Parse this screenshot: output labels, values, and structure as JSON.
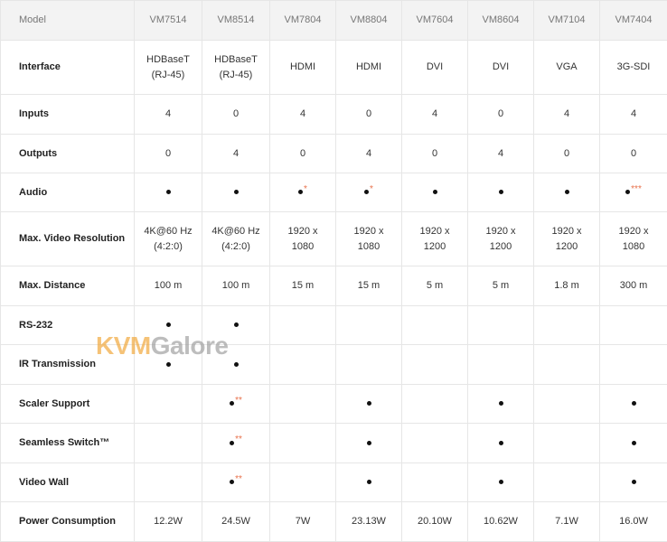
{
  "header": {
    "model_label": "Model",
    "models": [
      "VM7514",
      "VM8514",
      "VM7804",
      "VM8804",
      "VM7604",
      "VM8604",
      "VM7104",
      "VM7404"
    ]
  },
  "rows": [
    {
      "label": "Interface",
      "cells": [
        "HDBaseT\n(RJ-45)",
        "HDBaseT\n(RJ-45)",
        "HDMI",
        "HDMI",
        "DVI",
        "DVI",
        "VGA",
        "3G-SDI"
      ]
    },
    {
      "label": "Inputs",
      "cells": [
        "4",
        "0",
        "4",
        "0",
        "4",
        "0",
        "4",
        "4"
      ]
    },
    {
      "label": "Outputs",
      "cells": [
        "0",
        "4",
        "0",
        "4",
        "0",
        "4",
        "0",
        "0"
      ]
    },
    {
      "label": "Audio",
      "dots": [
        true,
        true,
        true,
        true,
        true,
        true,
        true,
        true
      ],
      "notes": [
        "",
        "",
        "*",
        "*",
        "",
        "",
        "",
        "***"
      ]
    },
    {
      "label": "Max. Video Resolution",
      "cells": [
        "4K@60 Hz\n(4:2:0)",
        "4K@60 Hz\n(4:2:0)",
        "1920 x\n1080",
        "1920 x\n1080",
        "1920 x\n1200",
        "1920 x\n1200",
        "1920 x\n1200",
        "1920 x\n1080"
      ]
    },
    {
      "label": "Max. Distance",
      "cells": [
        "100 m",
        "100 m",
        "15 m",
        "15 m",
        "5 m",
        "5 m",
        "1.8 m",
        "300 m"
      ]
    },
    {
      "label": "RS-232",
      "dots": [
        true,
        true,
        false,
        false,
        false,
        false,
        false,
        false
      ],
      "notes": [
        "",
        "",
        "",
        "",
        "",
        "",
        "",
        ""
      ]
    },
    {
      "label": "IR Transmission",
      "dots": [
        true,
        true,
        false,
        false,
        false,
        false,
        false,
        false
      ],
      "notes": [
        "",
        "",
        "",
        "",
        "",
        "",
        "",
        ""
      ]
    },
    {
      "label": "Scaler Support",
      "dots": [
        false,
        true,
        false,
        true,
        false,
        true,
        false,
        true
      ],
      "notes": [
        "",
        "**",
        "",
        "",
        "",
        "",
        "",
        ""
      ]
    },
    {
      "label": "Seamless Switch™",
      "dots": [
        false,
        true,
        false,
        true,
        false,
        true,
        false,
        true
      ],
      "notes": [
        "",
        "**",
        "",
        "",
        "",
        "",
        "",
        ""
      ]
    },
    {
      "label": "Video Wall",
      "dots": [
        false,
        true,
        false,
        true,
        false,
        true,
        false,
        true
      ],
      "notes": [
        "",
        "**",
        "",
        "",
        "",
        "",
        "",
        ""
      ]
    },
    {
      "label": "Power Consumption",
      "cells": [
        "12.2W",
        "24.5W",
        "7W",
        "23.13W",
        "20.10W",
        "10.62W",
        "7.1W",
        "16.0W"
      ]
    }
  ],
  "watermark": {
    "part1": "KVM",
    "part2": "Galore"
  },
  "colors": {
    "header_bg": "#f3f3f3",
    "grid": "#e6e6e6",
    "note": "#e8704a",
    "watermark_orange": "#f0a330",
    "watermark_gray": "#9a9a9a"
  }
}
